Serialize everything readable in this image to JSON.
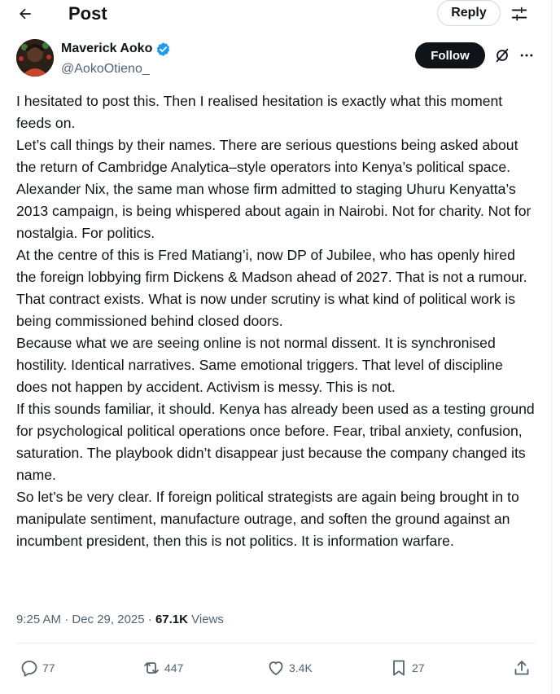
{
  "header": {
    "title": "Post",
    "reply_label": "Reply",
    "back_icon": "arrow-left-icon",
    "filter_icon": "sliders-icon"
  },
  "author": {
    "name": "Maverick Aoko",
    "handle": "@AokoOtieno_",
    "follow_label": "Follow",
    "verified_color": "#1d9bf0"
  },
  "post": {
    "paragraphs": [
      "I hesitated to post this. Then I realised hesitation is exactly what this moment feeds on.",
      "Let’s call things by their names. There are serious questions being asked about the return of Cambridge Analytica–style operators into Kenya’s political space. Alexander Nix, the same man whose firm admitted to staging Uhuru Kenyatta’s 2013 campaign, is being whispered about again in Nairobi. Not for charity. Not for nostalgia. For politics.",
      "At the centre of this is Fred Matiang’i, now DP of Jubilee, who has openly hired the foreign lobbying firm Dickens & Madson ahead of 2027. That is not a rumour. That contract exists. What is now under scrutiny is what kind of political work is being commissioned behind closed doors.",
      "Because what we are seeing online is not normal dissent. It is synchronised hostility. Identical narratives. Same emotional triggers. That level of discipline does not happen by accident. Activism is messy. This is not.",
      "If this sounds familiar, it should. Kenya has already been used as a testing ground for psychological political operations once before. Fear, tribal anxiety, confusion, saturation. The playbook didn’t disappear just because the company changed its name.",
      "So let’s be very clear. If foreign political strategists are again being brought in to manipulate sentiment, manufacture outrage, and soften the ground against an incumbent president, then this is not politics. It is information warfare."
    ],
    "time": "9:25 AM · Dec 29, 2025 · ",
    "views_count": "67.1K",
    "views_label": " Views"
  },
  "actions": {
    "replies": "77",
    "reposts": "447",
    "likes": "3.4K",
    "bookmarks": "27"
  }
}
